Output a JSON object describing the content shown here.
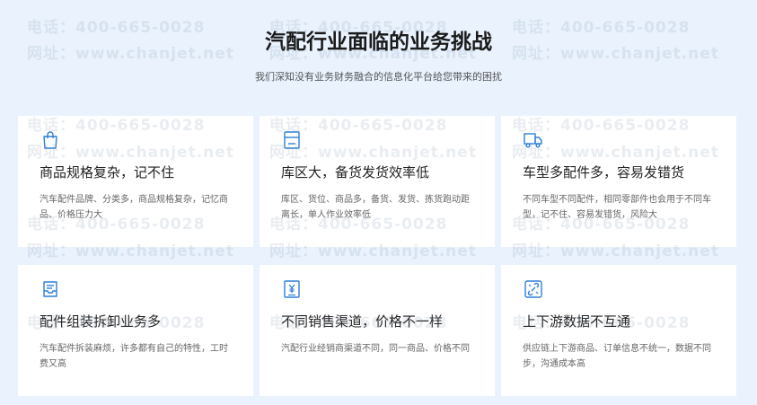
{
  "header": {
    "title": "汽配行业面临的业务挑战",
    "subtitle": "我们深知没有业务财务融合的信息化平台给您带来的困扰"
  },
  "watermark": {
    "phone": "电话：400-665-0028",
    "site": "网址：www.chanjet.net"
  },
  "cards": [
    {
      "icon": "shopping-bag-icon",
      "title": "商品规格复杂，记不住",
      "desc": "汽车配件品牌、分类多，商品规格复杂，记忆商品、价格压力大"
    },
    {
      "icon": "warehouse-doc-icon",
      "title": "库区大，备货发货效率低",
      "desc": "库区、货位、商品多，备货、发货、拣货跑动距离长，单人作业效率低"
    },
    {
      "icon": "truck-icon",
      "title": "车型多配件多，容易发错货",
      "desc": "不同车型不同配件，相同零部件也会用于不同车型，记不住、容易发错货，风险大"
    },
    {
      "icon": "inbox-tray-icon",
      "title": "配件组装拆卸业务多",
      "desc": "汽车配件拆装麻烦，许多都有自己的特性，工时费又高"
    },
    {
      "icon": "yuan-document-icon",
      "title": "不同销售渠道，价格不一样",
      "desc": "汽配行业经销商渠道不同，同一商品、价格不同"
    },
    {
      "icon": "broken-link-icon",
      "title": "上下游数据不互通",
      "desc": "供应链上下游商品、订单信息不统一，数据不同步，沟通成本高"
    }
  ],
  "colors": {
    "accent": "#2f7fd8",
    "background": "#e9f2fd",
    "card": "#ffffff"
  }
}
